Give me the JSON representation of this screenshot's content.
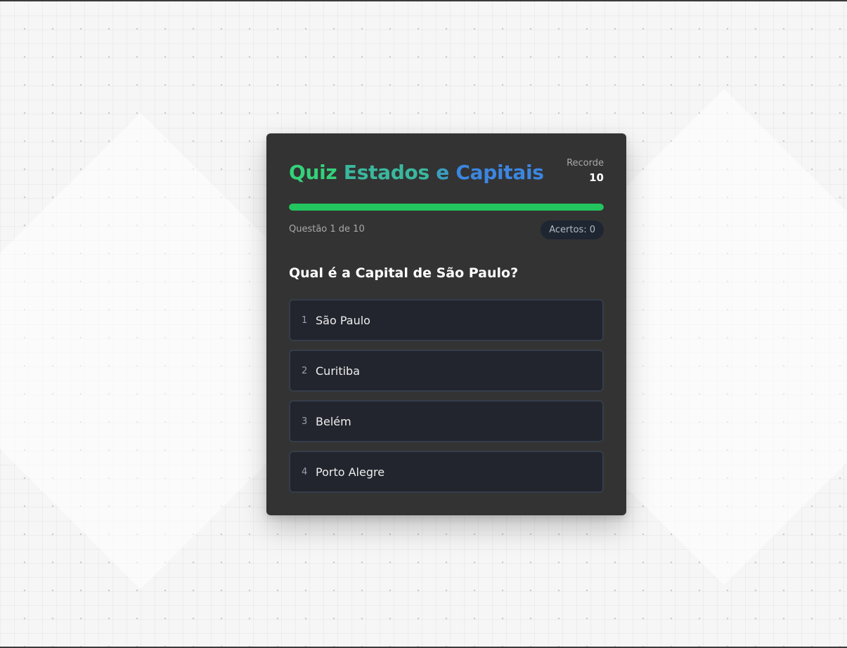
{
  "quiz": {
    "title_parts": [
      "Quiz",
      "Estados",
      "e",
      "Capitais"
    ],
    "record_label": "Recorde",
    "record_value": "10",
    "progress_fraction": 1.0,
    "question_counter": "Questão 1 de 10",
    "score_label": "Acertos: 0",
    "question": "Qual é a Capital de São Paulo?",
    "options": [
      {
        "number": "1",
        "label": "São Paulo"
      },
      {
        "number": "2",
        "label": "Curitiba"
      },
      {
        "number": "3",
        "label": "Belém"
      },
      {
        "number": "4",
        "label": "Porto Alegre"
      }
    ]
  },
  "colors": {
    "card_background": "#333333",
    "progress_fill": "#22c55e",
    "title_gradient_start": "#34d17a",
    "title_gradient_end": "#3b86e0",
    "option_background": "#22252d",
    "option_border": "#353d4b"
  }
}
